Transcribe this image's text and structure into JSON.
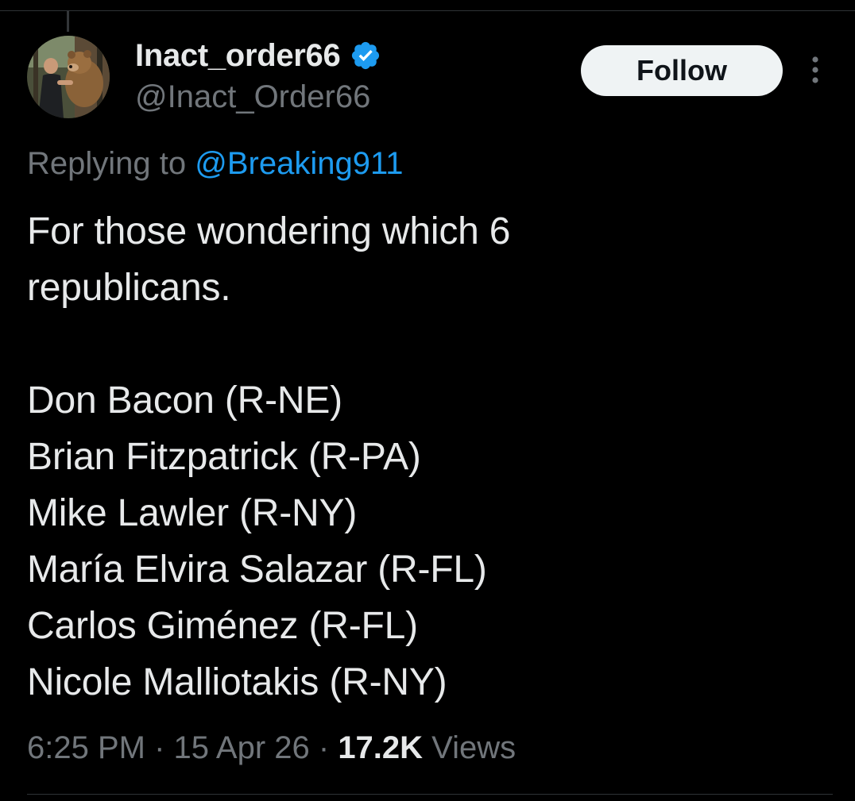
{
  "author": {
    "display_name": "Inact_order66",
    "handle": "@Inact_Order66",
    "verified": true,
    "avatar_icon": "avatar-photo-man-with-bear"
  },
  "follow_button": {
    "label": "Follow"
  },
  "more_icon": "more-vertical-dots-icon",
  "reply": {
    "prefix": "Replying to ",
    "handle": "@Breaking911"
  },
  "tweet": {
    "lines": [
      "For those wondering which 6",
      "republicans.",
      "",
      "Don Bacon (R-NE)",
      "Brian Fitzpatrick (R-PA)",
      "Mike Lawler (R-NY)",
      "María Elvira Salazar (R-FL)",
      "Carlos Giménez (R-FL)",
      "Nicole Malliotakis (R-NY)"
    ]
  },
  "meta": {
    "time": "6:25 PM",
    "separator": " · ",
    "date": "15 Apr 26",
    "views_count": "17.2K",
    "views_label": " Views"
  },
  "colors": {
    "background": "#000000",
    "text": "#e7e9ea",
    "secondary_text": "#71767b",
    "link": "#1d9bf0",
    "verified": "#1d9bf0",
    "follow_bg": "#eff3f4",
    "divider": "#2f3336"
  }
}
